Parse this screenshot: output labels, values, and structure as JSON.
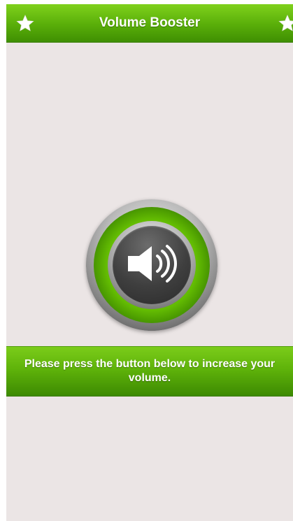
{
  "header": {
    "title": "Volume Booster",
    "left_icon": "star-icon",
    "right_icon": "star-icon"
  },
  "main": {
    "button_icon": "speaker-volume-icon",
    "instruction": "Please press the button below to increase your volume."
  },
  "colors": {
    "accent_green": "#59ae09",
    "background": "#ebe5e5",
    "text_light": "#ffffff"
  }
}
